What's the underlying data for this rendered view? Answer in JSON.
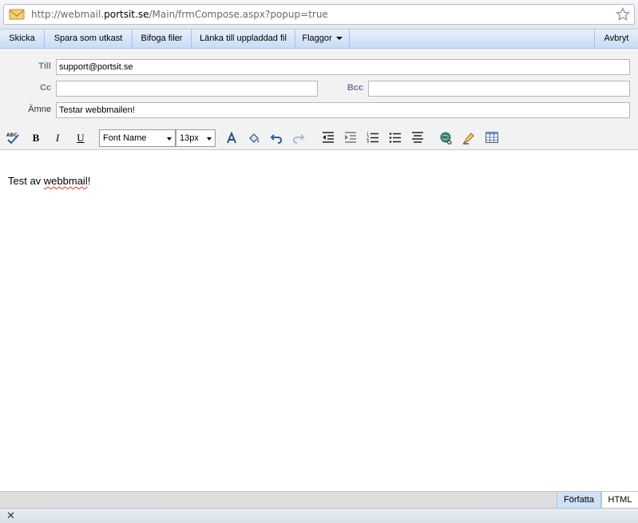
{
  "browser": {
    "url_prefix": "http://webmail.",
    "url_host": "portsit.se",
    "url_path": "/Main/frmCompose.aspx?popup=true"
  },
  "toolbar": {
    "send": "Skicka",
    "save_draft": "Spara som utkast",
    "attach": "Bifoga filer",
    "link_file": "Länka till uppladdad fil",
    "flags": "Flaggor",
    "cancel": "Avbryt"
  },
  "fields": {
    "to_label": "Till",
    "to_value": "support@portsit.se",
    "cc_label": "Cc",
    "cc_value": "",
    "bcc_label": "Bcc",
    "bcc_value": "",
    "subject_label": "Ämne",
    "subject_value": "Testar webbmailen!"
  },
  "format_toolbar": {
    "spellcheck": "ABC",
    "bold": "B",
    "italic": "I",
    "underline": "U",
    "font_name": "Font Name",
    "font_size": "13px"
  },
  "editor": {
    "text_before": "Test av ",
    "text_misspelled": "webbmail",
    "text_after": "!"
  },
  "modes": {
    "compose": "Författa",
    "html": "HTML"
  },
  "icons": [
    "mail-envelope-icon",
    "bookmark-star-icon",
    "spellcheck-icon",
    "font-color-icon",
    "highlight-color-icon",
    "undo-icon",
    "redo-icon",
    "outdent-icon",
    "indent-icon",
    "ordered-list-icon",
    "unordered-list-icon",
    "justify-icon",
    "insert-link-icon",
    "remove-format-icon",
    "insert-table-icon",
    "close-icon"
  ],
  "colors": {
    "toolbar_bg": "#c9dcf4",
    "label_color": "#6d7a92",
    "active_mode_bg": "#cfe1f6"
  }
}
